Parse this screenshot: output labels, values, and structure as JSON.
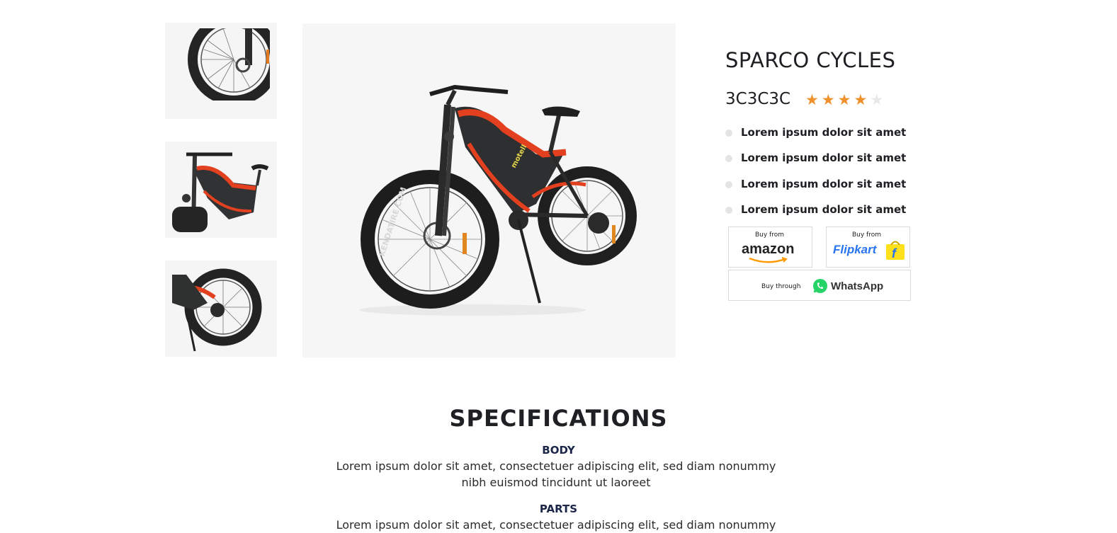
{
  "gallery": {
    "thumbnails": [
      "front-wheel-view",
      "frame-view",
      "rear-wheel-view"
    ],
    "main_image": "electric-fat-tire-bicycle",
    "tire_text": "KENDATIRE.COM",
    "frame_text": "motell"
  },
  "product": {
    "title": "SPARCO CYCLES",
    "code": "3C3C3C",
    "rating": 4,
    "rating_max": 5,
    "star_color": "#f0902a",
    "star_empty_color": "#e8e8e8",
    "features": [
      "Lorem ipsum dolor sit amet",
      "Lorem ipsum dolor sit amet",
      "Lorem ipsum dolor sit amet",
      "Lorem ipsum dolor sit amet"
    ]
  },
  "buy": {
    "amazon": {
      "prefix": "Buy from",
      "name": "amazon"
    },
    "flipkart": {
      "prefix": "Buy from",
      "name": "Flipkart"
    },
    "whatsapp": {
      "prefix": "Buy through",
      "name": "WhatsApp"
    }
  },
  "specifications": {
    "heading": "SPECIFICATIONS",
    "sections": [
      {
        "title": "BODY",
        "text": "Lorem ipsum dolor sit amet, consectetuer adipiscing elit, sed diam nonummy nibh euismod tincidunt ut laoreet"
      },
      {
        "title": "PARTS",
        "text": "Lorem ipsum dolor sit amet, consectetuer adipiscing elit, sed diam nonummy"
      }
    ]
  },
  "colors": {
    "accent_red": "#e2401f",
    "frame_dark": "#2d2f30",
    "amazon_orange": "#ff9900",
    "flipkart_blue": "#2874f0",
    "flipkart_yellow": "#ffe11b",
    "whatsapp_green": "#25d366"
  }
}
